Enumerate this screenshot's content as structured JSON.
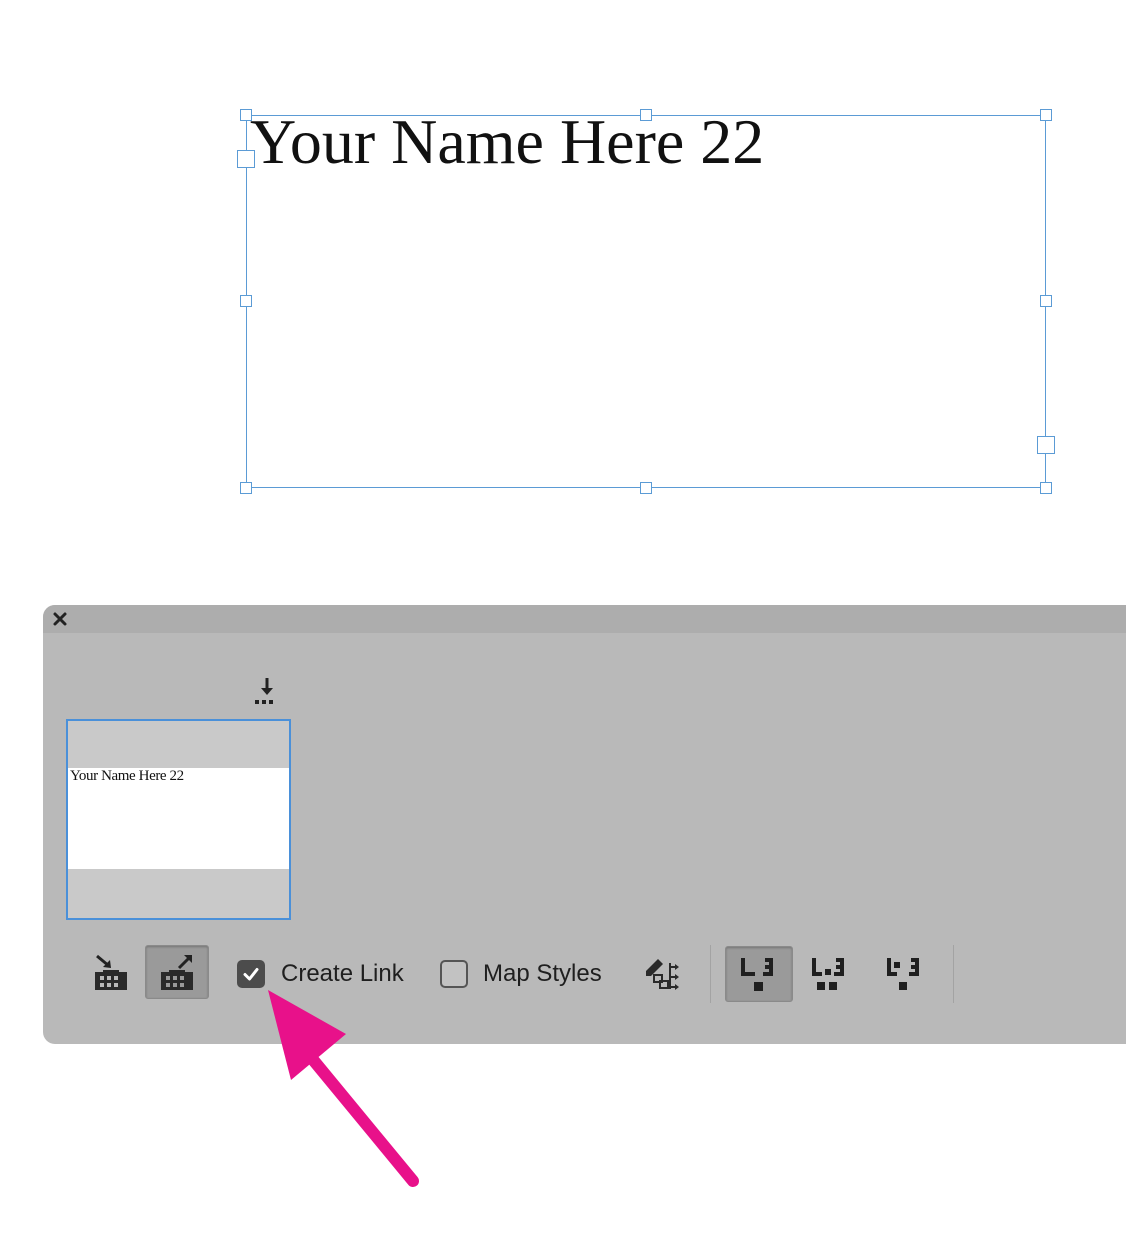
{
  "canvas": {
    "frame_text": "Your Name Here 22",
    "frame_border_color": "#5b9bd5"
  },
  "panel": {
    "close_icon": "close-icon",
    "download_icon": "place-download-icon",
    "thumbnail": {
      "text": "Your Name Here 22"
    },
    "toolbar": {
      "collect_icon": "collect-content-icon",
      "place_icon": "place-content-icon",
      "create_link": {
        "label": "Create Link",
        "checked": true
      },
      "map_styles": {
        "label": "Map Styles",
        "checked": false
      },
      "edit_mapping_icon": "edit-style-mapping-icon",
      "mode_buttons": [
        {
          "icon": "place-and-remove-icon",
          "active": true
        },
        {
          "icon": "place-multiple-keep-icon",
          "active": false
        },
        {
          "icon": "place-keep-icon",
          "active": false
        }
      ]
    }
  },
  "annotation": {
    "arrow_color": "#e8118a"
  }
}
